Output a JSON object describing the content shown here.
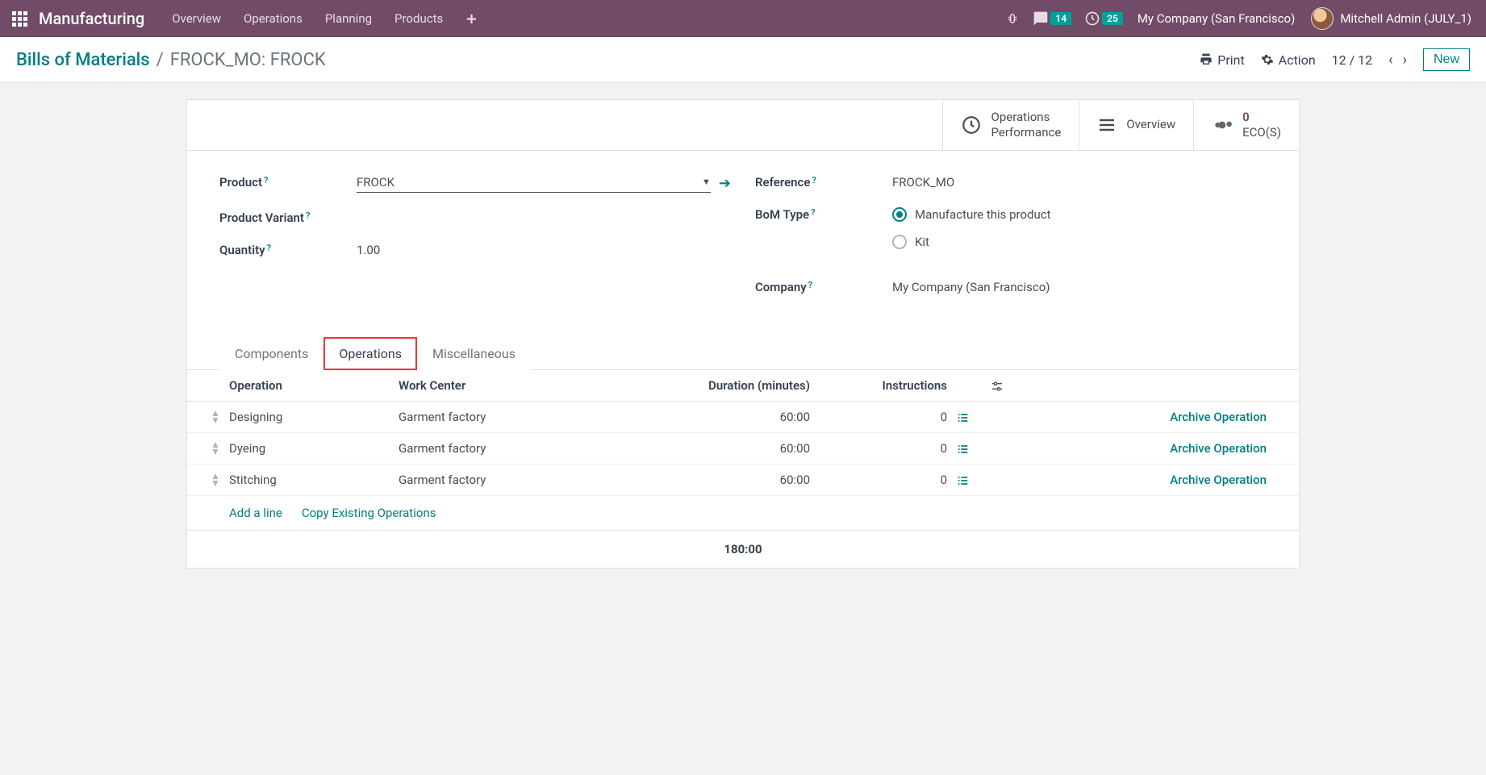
{
  "topbar": {
    "brand": "Manufacturing",
    "nav": [
      "Overview",
      "Operations",
      "Planning",
      "Products"
    ],
    "chat_badge": "14",
    "activity_badge": "25",
    "company": "My Company (San Francisco)",
    "user": "Mitchell Admin (JULY_1)"
  },
  "breadcrumb": {
    "root": "Bills of Materials",
    "current": "FROCK_MO: FROCK",
    "print": "Print",
    "action": "Action",
    "pager": "12 / 12",
    "new": "New"
  },
  "statbar": {
    "ops_perf_l1": "Operations",
    "ops_perf_l2": "Performance",
    "overview": "Overview",
    "ecos_count": "0",
    "ecos_label": "ECO(S)"
  },
  "form": {
    "labels": {
      "product": "Product",
      "variant": "Product Variant",
      "quantity": "Quantity",
      "reference": "Reference",
      "bom_type": "BoM Type",
      "company": "Company"
    },
    "product": "FROCK",
    "quantity": "1.00",
    "reference": "FROCK_MO",
    "bom_type_options": {
      "manufacture": "Manufacture this product",
      "kit": "Kit"
    },
    "company": "My Company (San Francisco)"
  },
  "tabs": {
    "components": "Components",
    "operations": "Operations",
    "misc": "Miscellaneous"
  },
  "grid": {
    "headers": {
      "operation": "Operation",
      "work_center": "Work Center",
      "duration": "Duration (minutes)",
      "instructions": "Instructions"
    },
    "rows": [
      {
        "operation": "Designing",
        "work_center": "Garment factory",
        "duration": "60:00",
        "instructions": "0",
        "archive": "Archive Operation"
      },
      {
        "operation": "Dyeing",
        "work_center": "Garment factory",
        "duration": "60:00",
        "instructions": "0",
        "archive": "Archive Operation"
      },
      {
        "operation": "Stitching",
        "work_center": "Garment factory",
        "duration": "60:00",
        "instructions": "0",
        "archive": "Archive Operation"
      }
    ],
    "add_line": "Add a line",
    "copy_existing": "Copy Existing Operations",
    "total_duration": "180:00"
  }
}
